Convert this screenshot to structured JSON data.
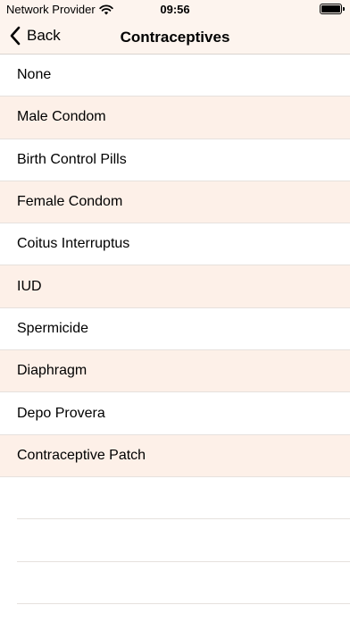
{
  "status_bar": {
    "carrier": "Network Provider",
    "time": "09:56",
    "wifi_icon": "wifi-icon",
    "battery_icon": "battery-icon"
  },
  "nav": {
    "back_label": "Back",
    "title": "Contraceptives",
    "back_icon": "chevron-left-icon"
  },
  "colors": {
    "bar_background": "#fdf4ee",
    "row_tint": "#fdf0e8",
    "separator": "#e6e1dd"
  },
  "items": [
    {
      "label": "None"
    },
    {
      "label": "Male Condom"
    },
    {
      "label": "Birth Control Pills"
    },
    {
      "label": "Female Condom"
    },
    {
      "label": "Coitus Interruptus"
    },
    {
      "label": "IUD"
    },
    {
      "label": "Spermicide"
    },
    {
      "label": "Diaphragm"
    },
    {
      "label": "Depo Provera"
    },
    {
      "label": "Contraceptive Patch"
    }
  ]
}
